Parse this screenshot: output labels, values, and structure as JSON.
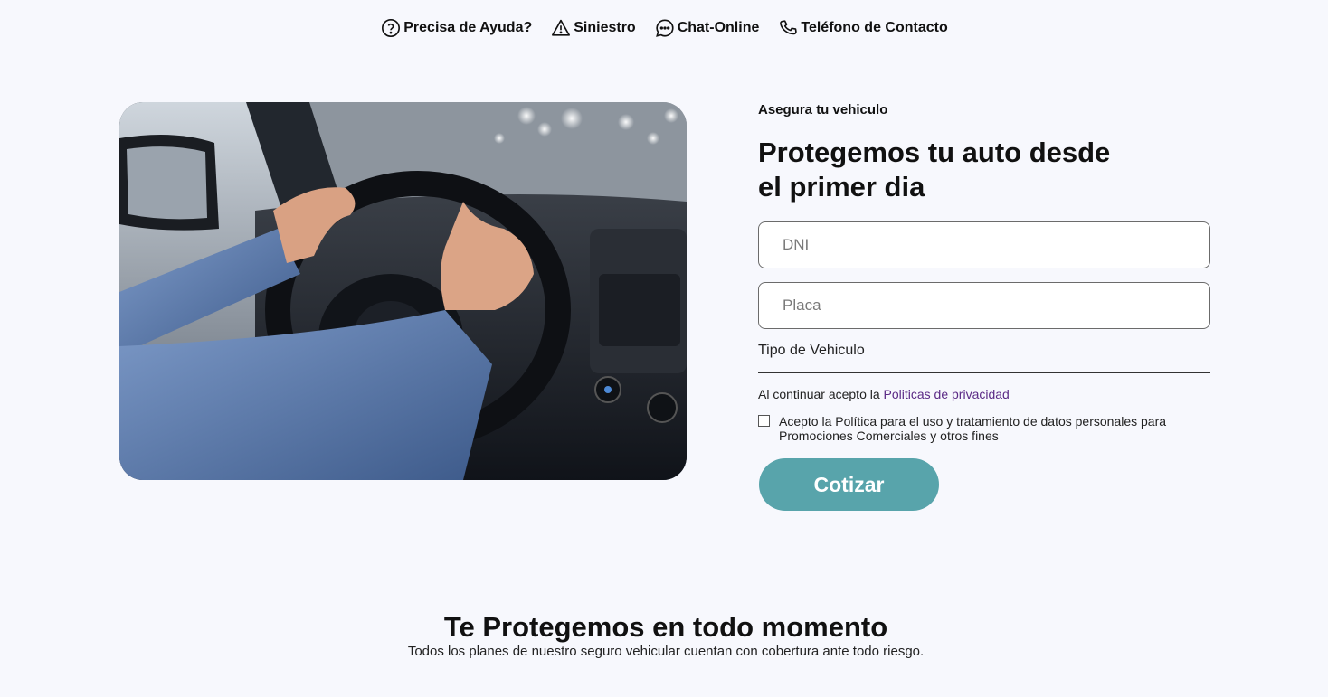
{
  "topnav": {
    "items": [
      {
        "label": "Precisa de Ayuda?",
        "icon": "question-circle-icon"
      },
      {
        "label": "Siniestro",
        "icon": "warning-triangle-icon"
      },
      {
        "label": "Chat-Online",
        "icon": "chat-bubble-icon"
      },
      {
        "label": "Teléfono de Contacto",
        "icon": "phone-icon"
      }
    ]
  },
  "hero": {
    "image": "driver-hands-on-steering-wheel"
  },
  "form": {
    "eyebrow": "Asegura tu vehiculo",
    "headline": "Protegemos tu auto desde el primer dia",
    "dni_placeholder": "DNI",
    "placa_placeholder": "Placa",
    "vehicle_type_label": "Tipo de Vehiculo",
    "privacy_prefix": "Al continuar acepto la ",
    "privacy_link": "Politicas de privacidad",
    "consent_text": "Acepto la Política para el uso y tratamiento de datos personales para Promociones Comerciales y otros fines",
    "submit_label": "Cotizar"
  },
  "section": {
    "title": "Te Protegemos en todo momento",
    "subtitle": "Todos los planes de nuestro seguro vehicular cuentan con cobertura ante todo riesgo."
  },
  "colors": {
    "background": "#f7f8fd",
    "button": "#58a4ab",
    "link": "#5b2a86"
  }
}
